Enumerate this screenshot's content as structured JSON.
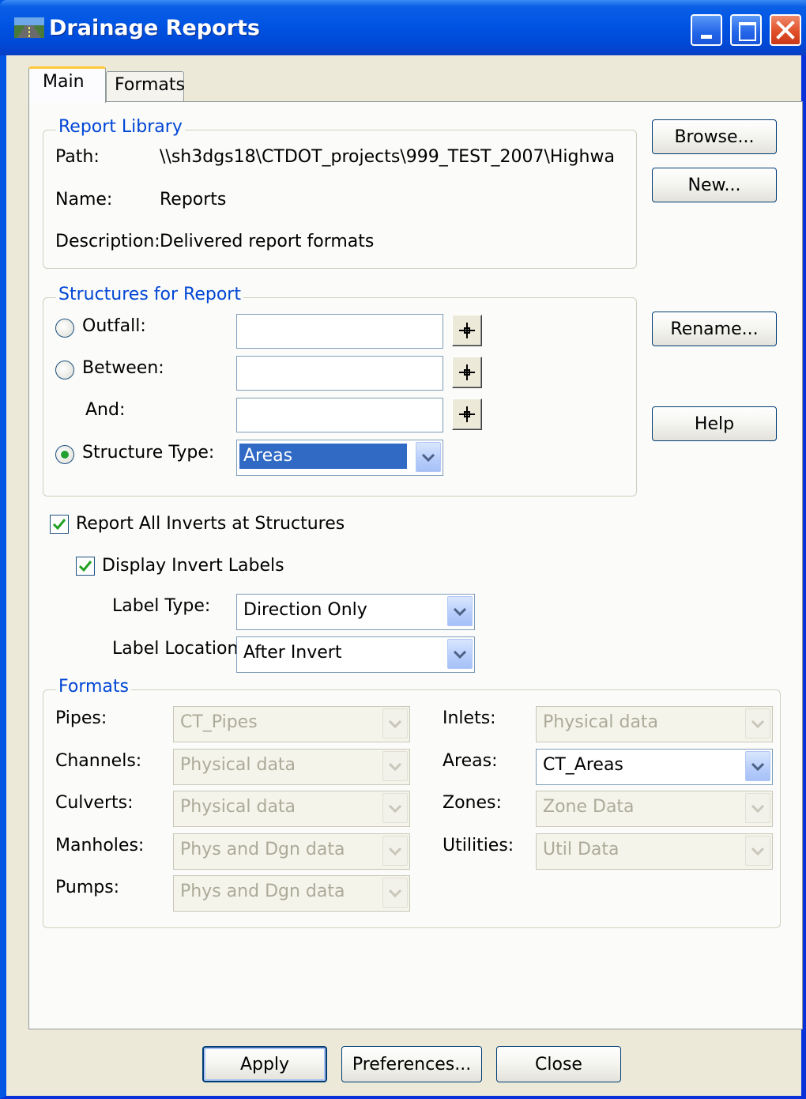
{
  "window": {
    "title": "Drainage Reports"
  },
  "tabs": [
    {
      "label": "Main"
    },
    {
      "label": "Formats"
    }
  ],
  "report_library": {
    "legend": "Report Library",
    "path_label": "Path:",
    "path_value": "\\\\sh3dgs18\\CTDOT_projects\\999_TEST_2007\\Highwa",
    "name_label": "Name:",
    "name_value": "Reports",
    "description_label": "Description:",
    "description_value": "Delivered report formats"
  },
  "side_buttons": {
    "browse": "Browse...",
    "new": "New...",
    "rename": "Rename...",
    "help": "Help"
  },
  "structures": {
    "legend": "Structures for Report",
    "outfall_label": "Outfall:",
    "between_label": "Between:",
    "and_label": "And:",
    "structure_type_label": "Structure Type:",
    "structure_type_value": "Areas",
    "selected_option": "Structure Type"
  },
  "inverts": {
    "report_all_label": "Report All Inverts at Structures",
    "report_all_checked": true,
    "display_labels_label": "Display Invert Labels",
    "display_labels_checked": true,
    "label_type_label": "Label Type:",
    "label_type_value": "Direction Only",
    "label_location_label": "Label Location:",
    "label_location_value": "After Invert"
  },
  "formats": {
    "legend": "Formats",
    "left": [
      {
        "label": "Pipes:",
        "value": "CT_Pipes",
        "enabled": false
      },
      {
        "label": "Channels:",
        "value": "Physical data",
        "enabled": false
      },
      {
        "label": "Culverts:",
        "value": "Physical data",
        "enabled": false
      },
      {
        "label": "Manholes:",
        "value": "Phys and Dgn data",
        "enabled": false
      },
      {
        "label": "Pumps:",
        "value": "Phys and Dgn data",
        "enabled": false
      }
    ],
    "right": [
      {
        "label": "Inlets:",
        "value": "Physical data",
        "enabled": false
      },
      {
        "label": "Areas:",
        "value": "CT_Areas",
        "enabled": true
      },
      {
        "label": "Zones:",
        "value": "Zone Data",
        "enabled": false
      },
      {
        "label": "Utilities:",
        "value": "Util Data",
        "enabled": false
      }
    ]
  },
  "footer": {
    "apply": "Apply",
    "preferences": "Preferences...",
    "close": "Close"
  }
}
